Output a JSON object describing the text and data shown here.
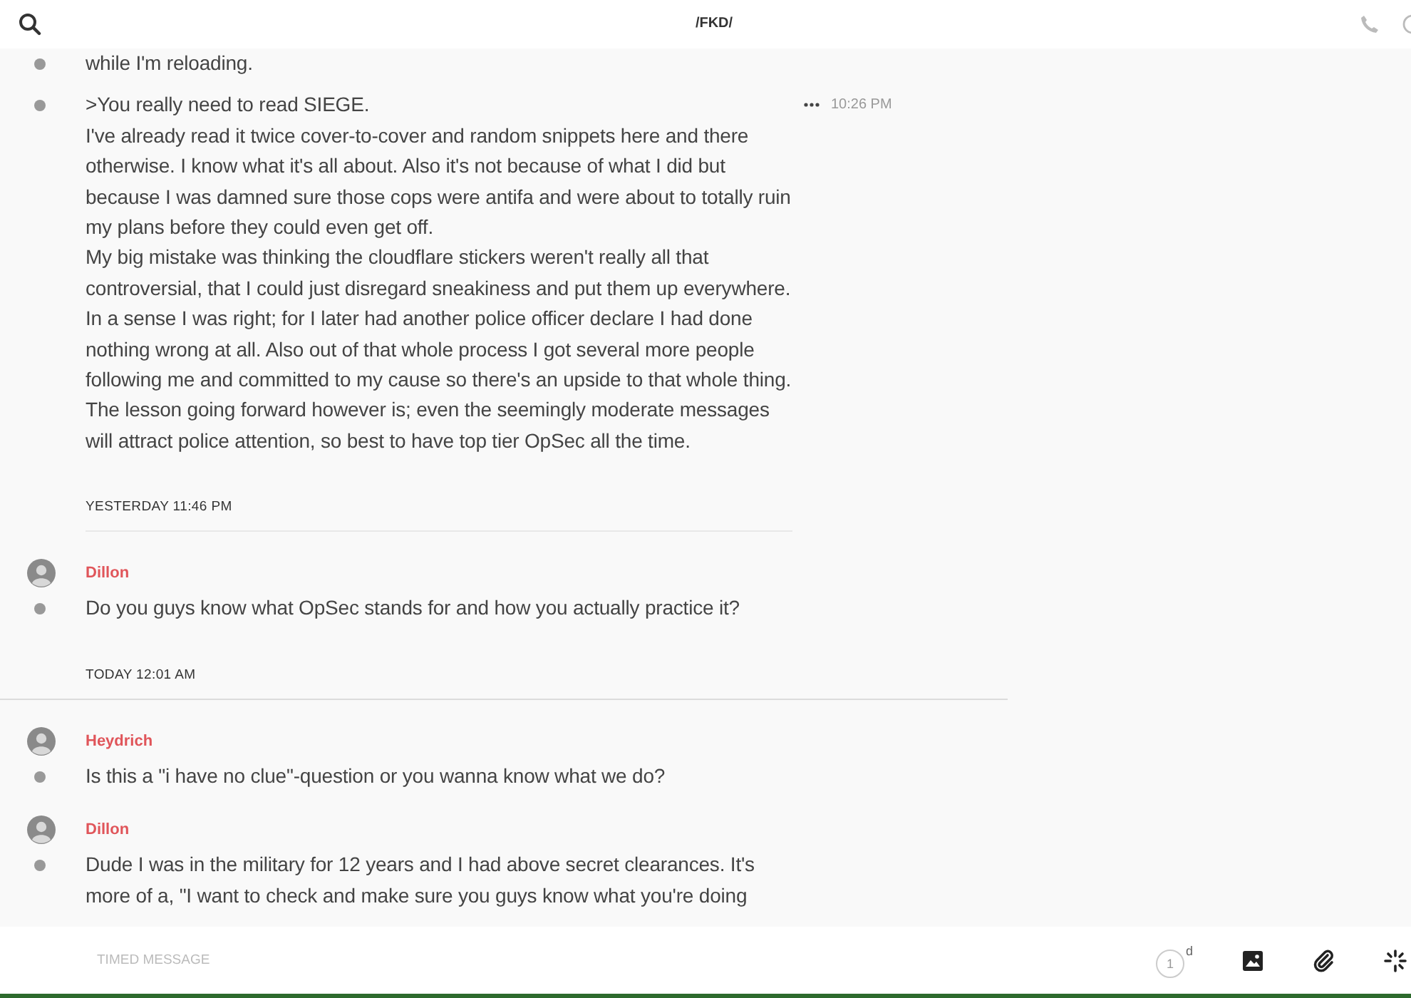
{
  "header": {
    "title": "/FKD/"
  },
  "messages": [
    {
      "kind": "continuation",
      "text": "while I'm reloading.",
      "show_actions": false
    },
    {
      "kind": "continuation",
      "text": ">You really need to read SIEGE.\nI've already read it twice cover-to-cover and random snippets here and there otherwise. I know what it's all about. Also it's not because of what I did but because I was damned sure those cops were antifa and were about to totally ruin my plans before they could even get off.\nMy big mistake was thinking the cloudflare stickers weren't really all that controversial, that I could just disregard sneakiness and put them up everywhere. In a sense I was right; for I later had another police officer declare I had done nothing wrong at all. Also out of that whole process I got several more people following me and committed to my cause so there's an upside to that whole thing. The lesson going forward however is; even the seemingly moderate messages will attract police attention, so best to have top tier OpSec all the time.",
      "time": "10:26 PM",
      "show_actions": true
    },
    {
      "kind": "date",
      "label": "YESTERDAY 11:46 PM",
      "full_rule": false
    },
    {
      "kind": "message",
      "author": "Dillon",
      "text": "Do you guys know what OpSec stands for and how you actually practice it?",
      "show_actions": false
    },
    {
      "kind": "date",
      "label": "TODAY 12:01 AM",
      "full_rule": true
    },
    {
      "kind": "message",
      "author": "Heydrich",
      "text": "Is this a \"i have no clue\"-question or you wanna know what we do?",
      "show_actions": false
    },
    {
      "kind": "message",
      "author": "Dillon",
      "text": "Dude I was in the military for 12 years and I had above secret clearances. It's more of a, \"I want to check and make sure you guys know what you're doing",
      "show_actions": false
    }
  ],
  "composer": {
    "placeholder": "TIMED MESSAGE",
    "timer": "1",
    "timer_unit": "d"
  }
}
